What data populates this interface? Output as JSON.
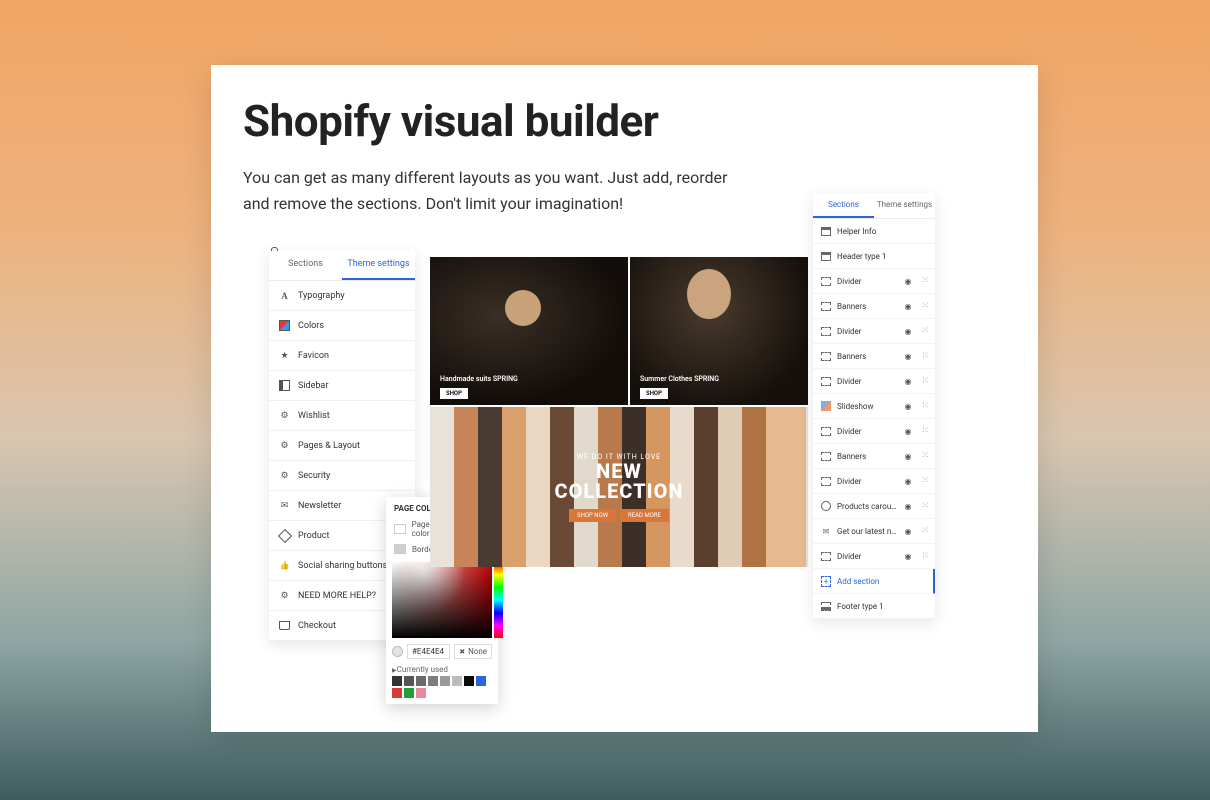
{
  "title": "Shopify visual builder",
  "subtitle": "You can get as many different layouts as you want. Just add, reorder and remove the sections. Don't limit your imagination!",
  "left_panel": {
    "tabs": {
      "sections": "Sections",
      "theme": "Theme settings"
    },
    "items": [
      {
        "label": "Typography",
        "icon": "type"
      },
      {
        "label": "Colors",
        "icon": "colors"
      },
      {
        "label": "Favicon",
        "icon": "favicon"
      },
      {
        "label": "Sidebar",
        "icon": "sidebar"
      },
      {
        "label": "Wishlist",
        "icon": "wish"
      },
      {
        "label": "Pages & Layout",
        "icon": "pages"
      },
      {
        "label": "Security",
        "icon": "security"
      },
      {
        "label": "Newsletter",
        "icon": "news"
      },
      {
        "label": "Product",
        "icon": "product"
      },
      {
        "label": "Social sharing buttons",
        "icon": "share"
      },
      {
        "label": "NEED MORE HELP?",
        "icon": "help"
      },
      {
        "label": "Checkout",
        "icon": "checkout"
      }
    ]
  },
  "color_picker": {
    "section_title": "PAGE COLORS",
    "row1": "Page background color",
    "row2": "Border color",
    "hex": "#E4E4E4",
    "none": "None",
    "currently_used": "Currently used",
    "swatches": [
      "#333333",
      "#555555",
      "#6b6b6b",
      "#7d7d7d",
      "#9a9a9a",
      "#bcbcbc",
      "#0a0a0a",
      "#2b65d9",
      "#d93a3a",
      "#1fa038",
      "#e68aa0"
    ]
  },
  "preview": {
    "tile_a_caption": "Handmade suits SPRING",
    "tile_b_caption": "Summer Clothes SPRING",
    "shop_btn": "SHOP",
    "tile_c_sub": "WE DO IT WITH LOVE",
    "tile_c_title_1": "NEW",
    "tile_c_title_2": "COLLECTION",
    "tile_c_btn1": "SHOP NOW",
    "tile_c_btn2": "READ MORE"
  },
  "right_panel": {
    "tabs": {
      "sections": "Sections",
      "theme": "Theme settings"
    },
    "fixed_top": [
      {
        "label": "Helper Info"
      },
      {
        "label": "Header type 1"
      }
    ],
    "items": [
      {
        "label": "Divider"
      },
      {
        "label": "Banners"
      },
      {
        "label": "Divider"
      },
      {
        "label": "Banners"
      },
      {
        "label": "Divider"
      },
      {
        "label": "Slideshow",
        "thumb": true
      },
      {
        "label": "Divider"
      },
      {
        "label": "Banners"
      },
      {
        "label": "Divider"
      },
      {
        "label": "Products carousel"
      },
      {
        "label": "Get our latest new..."
      },
      {
        "label": "Divider"
      }
    ],
    "add": "Add section",
    "footer": "Footer type 1"
  }
}
